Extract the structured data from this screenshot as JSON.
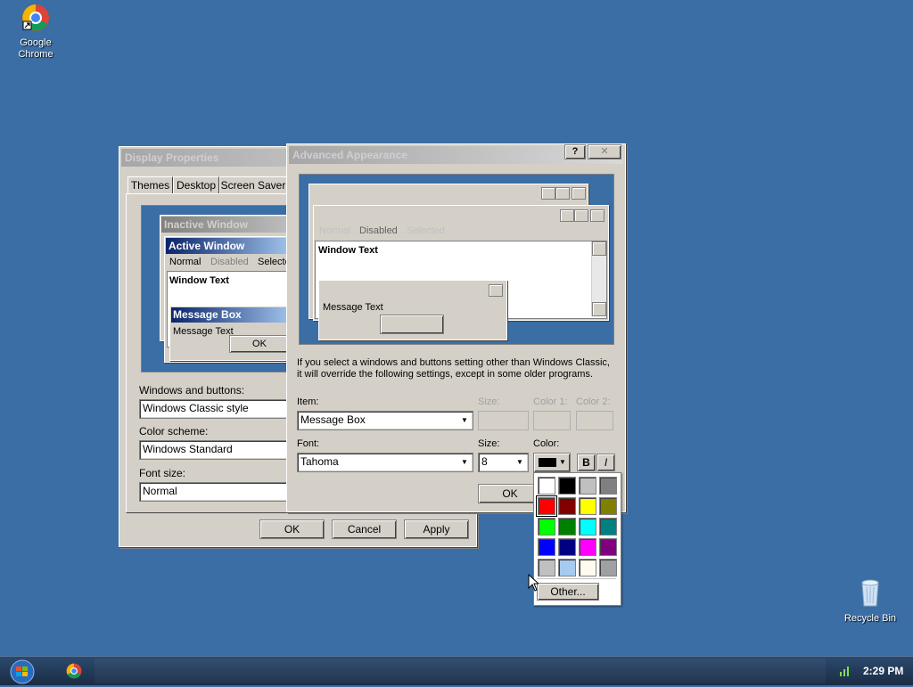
{
  "desktop": {
    "chrome_icon_label": "Google Chrome",
    "recycle_label": "Recycle Bin"
  },
  "display_properties": {
    "title": "Display Properties",
    "tabs": [
      "Themes",
      "Desktop",
      "Screen Saver"
    ],
    "preview": {
      "inactive_title": "Inactive Window",
      "active_title": "Active Window",
      "menu": [
        "Normal",
        "Disabled",
        "Selected"
      ],
      "window_text": "Window Text",
      "msgbox_title": "Message Box",
      "msgbox_text": "Message Text",
      "msgbox_ok": "OK"
    },
    "windows_buttons_label": "Windows and buttons:",
    "windows_buttons_value": "Windows Classic style",
    "color_scheme_label": "Color scheme:",
    "color_scheme_value": "Windows Standard",
    "font_size_label": "Font size:",
    "font_size_value": "Normal",
    "ok": "OK",
    "cancel": "Cancel",
    "apply": "Apply"
  },
  "advanced": {
    "title": "Advanced Appearance",
    "help_glyph": "?",
    "close_glyph": "✕",
    "preview": {
      "menu": [
        "Normal",
        "Disabled",
        "Selected"
      ],
      "window_text": "Window Text",
      "msg_text": "Message Text"
    },
    "info_text_1": "If you select a windows and buttons setting other than Windows Classic,",
    "info_text_2": "it will override the following settings, except in some older programs.",
    "item_label": "Item:",
    "item_value": "Message Box",
    "size_label": "Size:",
    "color1_label": "Color 1:",
    "color2_label": "Color 2:",
    "font_label": "Font:",
    "font_value": "Tahoma",
    "font_size_label": "Size:",
    "font_size_value": "8",
    "color_label": "Color:",
    "bold_glyph": "B",
    "italic_glyph": "I",
    "ok": "OK"
  },
  "color_picker": {
    "swatches": [
      "#ffffff",
      "#000000",
      "#c0c0c0",
      "#808080",
      "#ff0000",
      "#800000",
      "#ffff00",
      "#808000",
      "#00ff00",
      "#008000",
      "#00ffff",
      "#008080",
      "#0000ff",
      "#000080",
      "#ff00ff",
      "#800080",
      "#c0c0c0",
      "#a6caf0",
      "#fffbf0",
      "#a0a0a4"
    ],
    "selected_index": 4,
    "other_label": "Other..."
  },
  "taskbar": {
    "clock": "2:29 PM"
  },
  "icons": [
    "chrome-icon",
    "recycle-bin-icon",
    "start-orb-icon",
    "network-icon",
    "dropdown-arrow-icon",
    "help-icon",
    "close-icon"
  ]
}
